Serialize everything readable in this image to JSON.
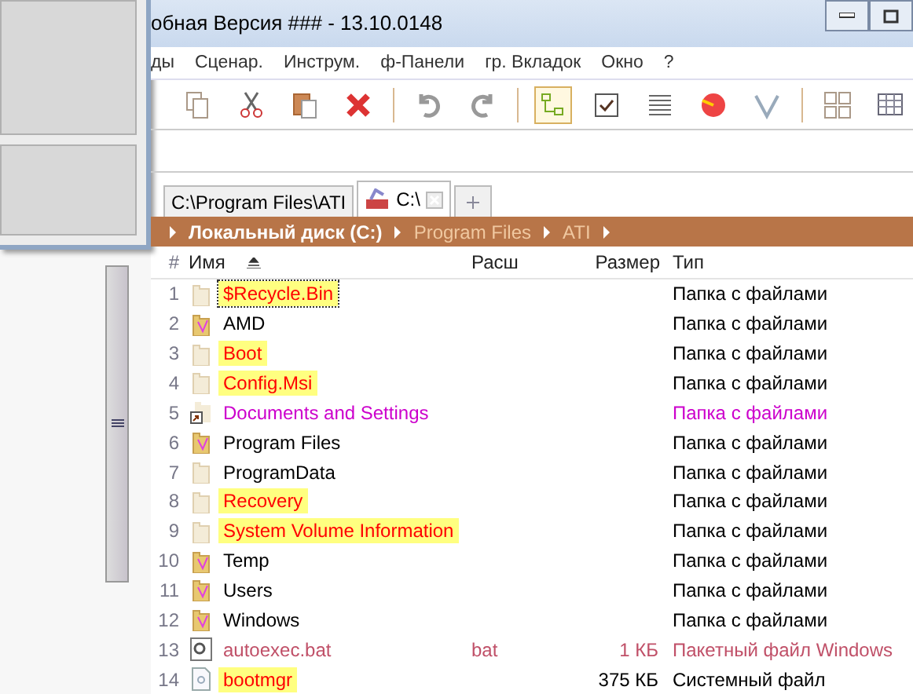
{
  "window": {
    "title": "обная Версия ### - 13.10.0148"
  },
  "menu": [
    "ды",
    "Сценар.",
    "Инструм.",
    "ф-Панели",
    "гр. Вкладок",
    "Окно",
    "?"
  ],
  "tabs": [
    {
      "label": "C:\\Program Files\\ATI",
      "selected": false
    },
    {
      "label": "C:\\",
      "selected": true
    }
  ],
  "breadcrumb": [
    {
      "label": "Локальный диск (C:)",
      "current": true
    },
    {
      "label": "Program Files",
      "current": false
    },
    {
      "label": "ATI",
      "current": false
    }
  ],
  "table": {
    "columns": [
      "#",
      "Имя",
      "Расш",
      "Размер",
      "Тип"
    ],
    "rows": [
      {
        "n": "1",
        "name": "$Recycle.Bin",
        "ext": "",
        "size": "",
        "type": "Папка с файлами",
        "kind": "folder-hidden",
        "color": "#ff0000",
        "highlighted": true,
        "focused": true
      },
      {
        "n": "2",
        "name": "AMD",
        "ext": "",
        "size": "",
        "type": "Папка с файлами",
        "kind": "folder",
        "color": "#000000",
        "highlighted": false,
        "focused": false
      },
      {
        "n": "3",
        "name": "Boot",
        "ext": "",
        "size": "",
        "type": "Папка с файлами",
        "kind": "folder-hidden",
        "color": "#ff0000",
        "highlighted": true,
        "focused": false
      },
      {
        "n": "4",
        "name": "Config.Msi",
        "ext": "",
        "size": "",
        "type": "Папка с файлами",
        "kind": "folder-hidden",
        "color": "#ff0000",
        "highlighted": true,
        "focused": false
      },
      {
        "n": "5",
        "name": "Documents and Settings",
        "ext": "",
        "size": "",
        "type": "Папка с файлами",
        "kind": "link",
        "color": "#cc00cc",
        "highlighted": false,
        "focused": false
      },
      {
        "n": "6",
        "name": "Program Files",
        "ext": "",
        "size": "",
        "type": "Папка с файлами",
        "kind": "folder",
        "color": "#000000",
        "highlighted": false,
        "focused": false
      },
      {
        "n": "7",
        "name": "ProgramData",
        "ext": "",
        "size": "",
        "type": "Папка с файлами",
        "kind": "folder-hidden",
        "color": "#000000",
        "highlighted": false,
        "focused": false
      },
      {
        "n": "8",
        "name": "Recovery",
        "ext": "",
        "size": "",
        "type": "Папка с файлами",
        "kind": "folder-hidden",
        "color": "#ff0000",
        "highlighted": true,
        "focused": false
      },
      {
        "n": "9",
        "name": "System Volume Information",
        "ext": "",
        "size": "",
        "type": "Папка с файлами",
        "kind": "folder-hidden",
        "color": "#ff0000",
        "highlighted": true,
        "focused": false
      },
      {
        "n": "10",
        "name": "Temp",
        "ext": "",
        "size": "",
        "type": "Папка с файлами",
        "kind": "folder",
        "color": "#000000",
        "highlighted": false,
        "focused": false
      },
      {
        "n": "11",
        "name": "Users",
        "ext": "",
        "size": "",
        "type": "Папка с файлами",
        "kind": "folder",
        "color": "#000000",
        "highlighted": false,
        "focused": false
      },
      {
        "n": "12",
        "name": "Windows",
        "ext": "",
        "size": "",
        "type": "Папка с файлами",
        "kind": "folder",
        "color": "#000000",
        "highlighted": false,
        "focused": false
      },
      {
        "n": "13",
        "name": "autoexec.bat",
        "ext": "bat",
        "size": "1 КБ",
        "type": "Пакетный файл Windows",
        "kind": "file-bat",
        "color": "#c05068",
        "highlighted": false,
        "focused": false
      },
      {
        "n": "14",
        "name": "bootmgr",
        "ext": "",
        "size": "375 КБ",
        "type": "Системный файл",
        "kind": "file",
        "color": "#ff0000",
        "highlighted": true,
        "focused": false
      }
    ]
  }
}
